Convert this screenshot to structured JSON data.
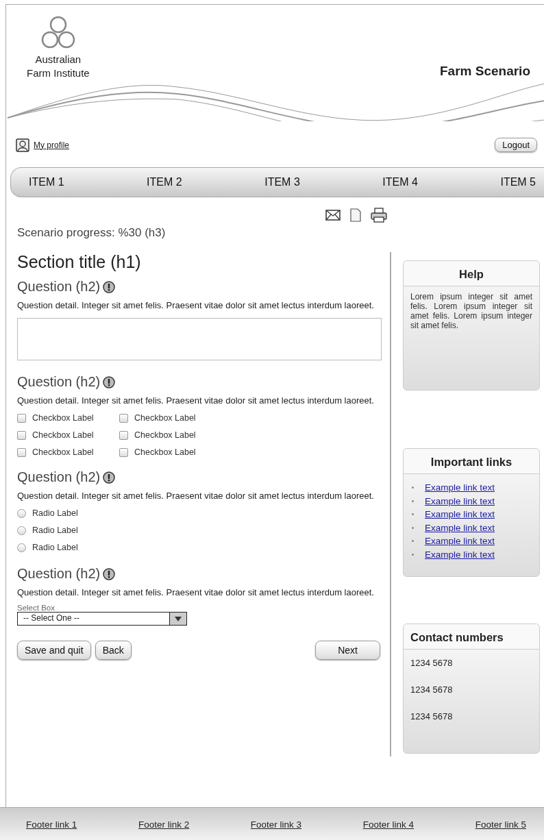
{
  "logo": {
    "lines": [
      "Australian",
      "Farm Institute"
    ]
  },
  "title": "Farm Scenario",
  "profile_link": "My profile",
  "logout_button": "Logout",
  "nav": [
    "ITEM 1",
    "ITEM 2",
    "ITEM 3",
    "ITEM 4",
    "ITEM 5"
  ],
  "progress": "Scenario progress: %30 (h3)",
  "section_title": "Section title (h1)",
  "questions": [
    {
      "kind": "text",
      "title": "Question (h2)",
      "detail": "Question detail. Integer sit amet felis. Praesent vitae dolor sit amet lectus interdum laoreet."
    },
    {
      "kind": "checkboxes",
      "title": "Question (h2)",
      "detail": "Question detail. Integer sit amet felis. Praesent vitae dolor sit amet lectus interdum laoreet.",
      "options": [
        {
          "label": "Checkbox Label",
          "checked": false
        },
        {
          "label": "Checkbox Label",
          "checked": false
        },
        {
          "label": "Checkbox Label",
          "checked": false
        },
        {
          "label": "Checkbox Label",
          "checked": false
        },
        {
          "label": "Checkbox Label",
          "checked": false
        },
        {
          "label": "Checkbox Label",
          "checked": false
        }
      ]
    },
    {
      "kind": "radios",
      "title": "Question (h2)",
      "detail": "Question detail. Integer sit amet felis. Praesent vitae dolor sit amet lectus interdum laoreet.",
      "options": [
        {
          "label": "Radio Label",
          "selected": false
        },
        {
          "label": "Radio Label",
          "selected": false
        },
        {
          "label": "Radio Label",
          "selected": false
        }
      ]
    },
    {
      "kind": "select",
      "title": "Question (h2)",
      "detail": "Question detail. Integer sit amet felis. Praesent vitae dolor sit amet lectus interdum laoreet.",
      "select_label": "Select Box",
      "select_value": "-- Select One --"
    }
  ],
  "buttons": {
    "left": [
      "Save and quit",
      "Back"
    ],
    "right": [
      "Next"
    ]
  },
  "help": {
    "title": "Help",
    "text": "Lorem ipsum integer sit amet felis. Lorem ipsum integer sit amet felis. Lorem ipsum integer sit amet felis."
  },
  "important_links": {
    "title": "Important links",
    "links": [
      "Example link text",
      "Example link text",
      "Example link text",
      "Example link text",
      "Example link text",
      "Example link text"
    ]
  },
  "contact_numbers": {
    "title": "Contact numbers",
    "numbers": [
      "1234 5678",
      "1234 5678",
      "1234 5678"
    ]
  },
  "footer": [
    "Footer link 1",
    "Footer link 2",
    "Footer link 3",
    "Footer link 4",
    "Footer link 5"
  ]
}
